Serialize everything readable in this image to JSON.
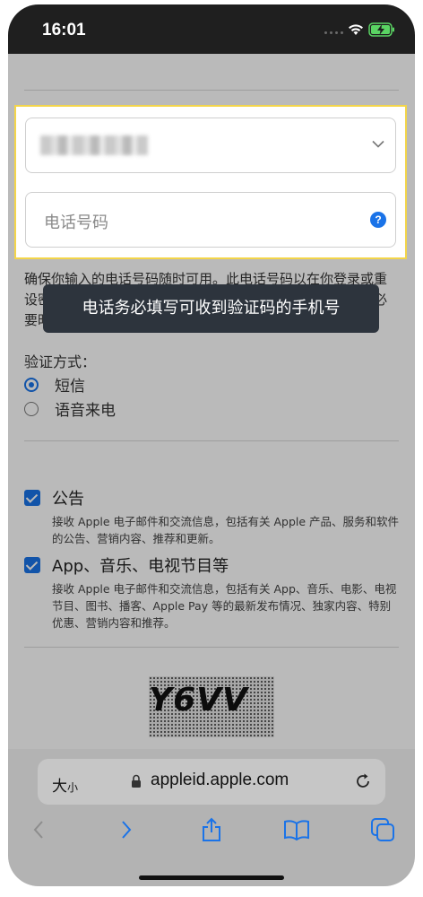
{
  "status_bar": {
    "time": "16:01"
  },
  "form": {
    "country_select_value": "",
    "phone_placeholder": "电话号码",
    "help_icon_text": "?",
    "note_text": "确保你输入的电话号码随时可用。此电话号码以在你登录或重设密码时验证你的身份，并帮助你在必要时找回账户，或在必要时短信接收是否能",
    "tooltip_text": "电话务必填写可收到验证码的手机号",
    "verify_label": "验证方式：",
    "verify_options": [
      {
        "label": "短信",
        "selected": true
      },
      {
        "label": "语音来电",
        "selected": false
      }
    ],
    "subscriptions": [
      {
        "title": "公告",
        "checked": true,
        "description": "接收 Apple 电子邮件和交流信息，包括有关 Apple 产品、服务和软件的公告、营销内容、推荐和更新。"
      },
      {
        "title": "App、音乐、电视节目等",
        "checked": true,
        "description": "接收 Apple 电子邮件和交流信息，包括有关 App、音乐、电影、电视节目、图书、播客、Apple Pay 等的最新发布情况、独家内容、特别优惠、营销内容和推荐。"
      }
    ],
    "captcha_text": "Y6VV"
  },
  "browser": {
    "text_size_big": "大",
    "text_size_small": "小",
    "url": "appleid.apple.com",
    "accent_color": "#1a73e8"
  }
}
